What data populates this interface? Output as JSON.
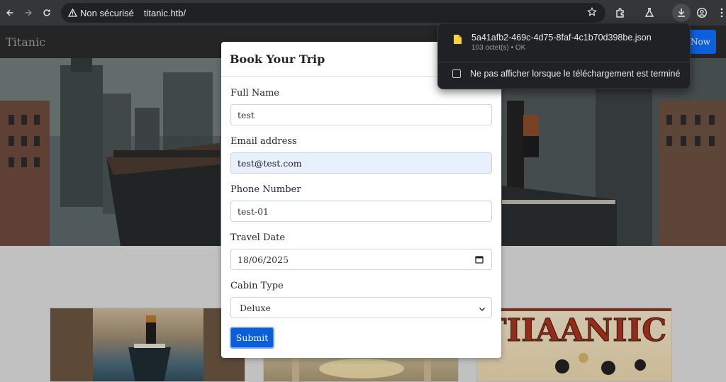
{
  "browser": {
    "security_label": "Non sécurisé",
    "url": "titanic.htb/"
  },
  "site": {
    "brand": "Titanic",
    "book_now": "Now"
  },
  "modal": {
    "title": "Book Your Trip",
    "fields": {
      "full_name": {
        "label": "Full Name",
        "value": "test"
      },
      "email": {
        "label": "Email address",
        "value": "test@test.com"
      },
      "phone": {
        "label": "Phone Number",
        "value": "test-01"
      },
      "travel_date": {
        "label": "Travel Date",
        "value": "18/06/2025"
      },
      "cabin_type": {
        "label": "Cabin Type",
        "value": "Deluxe"
      }
    },
    "submit_label": "Submit"
  },
  "downloads": {
    "file_name": "5a41afb2-469c-4d75-8faf-4c1b70d398be.json",
    "file_status": "103 octet(s) • OK",
    "checkbox_label": "Ne pas afficher lorsque le téléchargement est terminé"
  },
  "cards": {
    "poster_text": "TIIAANIIC"
  },
  "colors": {
    "primary": "#0d6efd",
    "autofill": "#e8f0fe",
    "chrome_bg": "#35363a"
  }
}
